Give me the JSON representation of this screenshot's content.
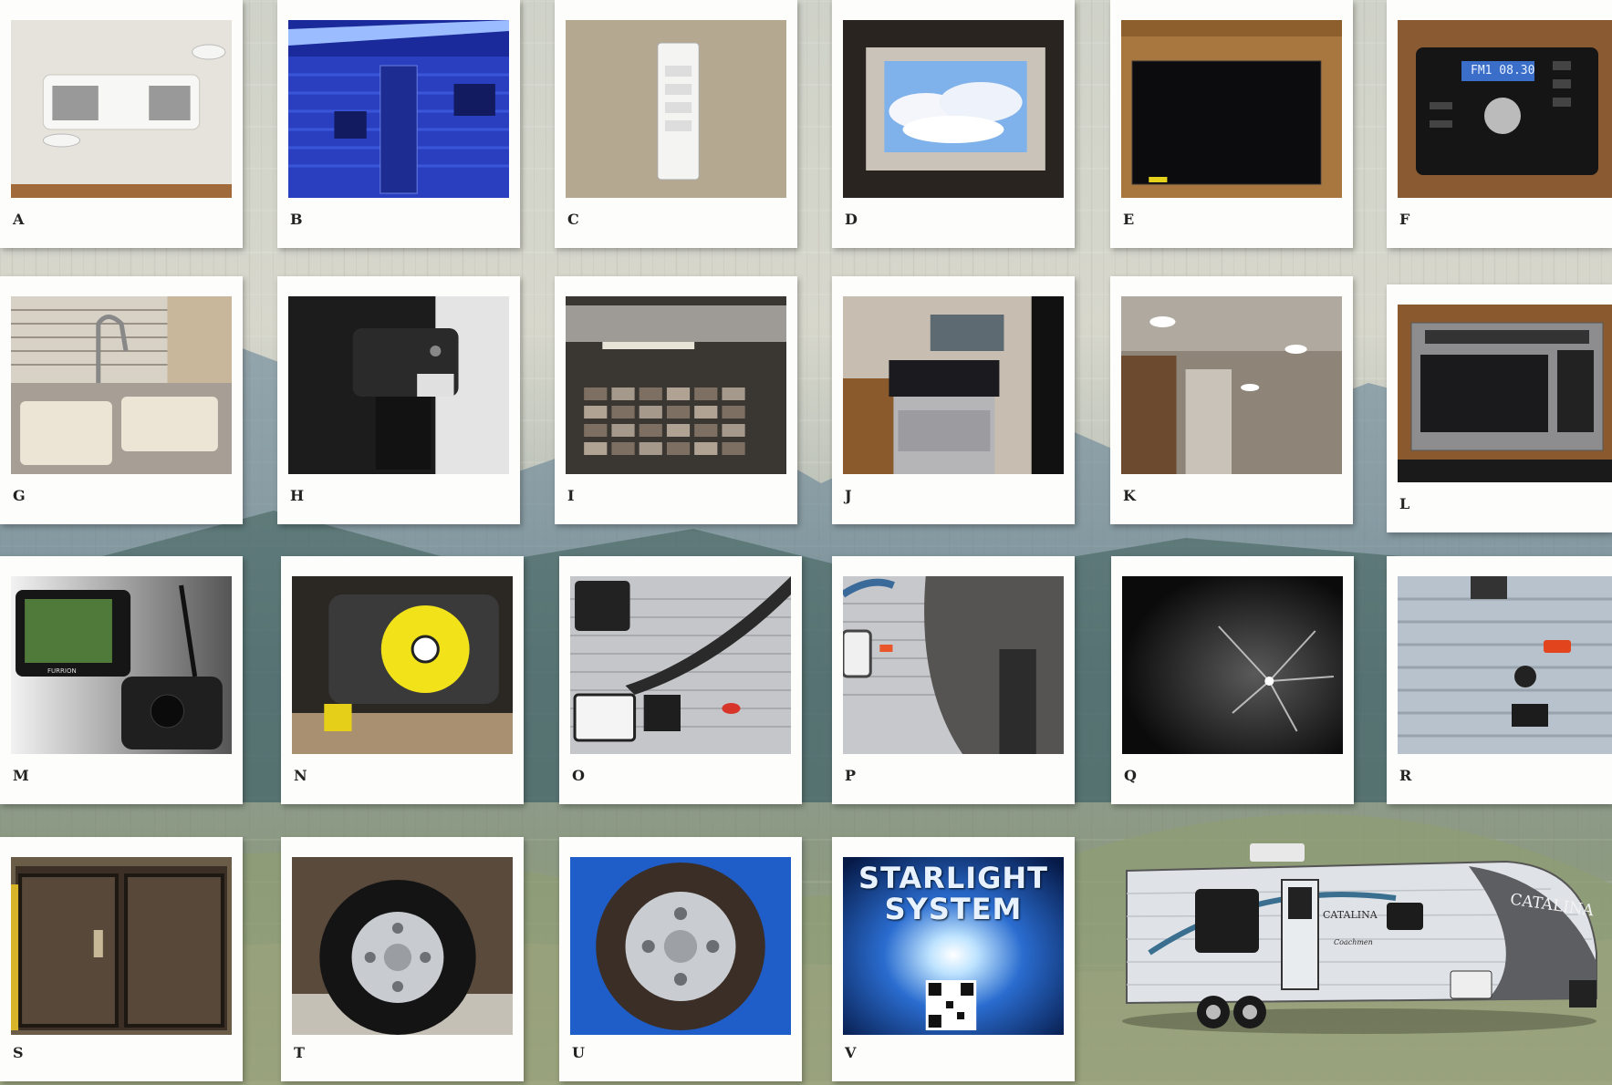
{
  "cards": [
    {
      "label": "A",
      "subject": "ceiling-air-conditioner"
    },
    {
      "label": "B",
      "subject": "trailer-awning-led-light"
    },
    {
      "label": "C",
      "subject": "wall-switch-panel"
    },
    {
      "label": "D",
      "subject": "skylight-window"
    },
    {
      "label": "E",
      "subject": "flat-screen-tv"
    },
    {
      "label": "F",
      "subject": "stereo-radio",
      "display": "FM1 08.30"
    },
    {
      "label": "G",
      "subject": "kitchen-sink"
    },
    {
      "label": "H",
      "subject": "power-jack-light"
    },
    {
      "label": "I",
      "subject": "range-hood-backsplash"
    },
    {
      "label": "J",
      "subject": "gas-range-oven"
    },
    {
      "label": "K",
      "subject": "ceiling-led-lights"
    },
    {
      "label": "L",
      "subject": "microwave"
    },
    {
      "label": "M",
      "subject": "backup-camera-monitor",
      "brand": "FURRION"
    },
    {
      "label": "N",
      "subject": "hitch-lock"
    },
    {
      "label": "O",
      "subject": "exterior-shower"
    },
    {
      "label": "P",
      "subject": "front-cap-marker-light"
    },
    {
      "label": "Q",
      "subject": "water-spray"
    },
    {
      "label": "R",
      "subject": "exterior-siding-port"
    },
    {
      "label": "S",
      "subject": "screen-room"
    },
    {
      "label": "T",
      "subject": "trailer-tire-mounted"
    },
    {
      "label": "U",
      "subject": "spare-tire"
    },
    {
      "label": "V",
      "subject": "starlight-system",
      "title_line1": "STARLIGHT",
      "title_line2": "SYSTEM"
    }
  ],
  "trailer": {
    "brand": "CATALINA",
    "side_brand": "CATALINA",
    "maker": "Coachmen"
  },
  "colors": {
    "card": "#fdfdfb",
    "label": "#222222",
    "starlight_bg": "#0a2a6a",
    "lock_yellow": "#f1e21a"
  }
}
